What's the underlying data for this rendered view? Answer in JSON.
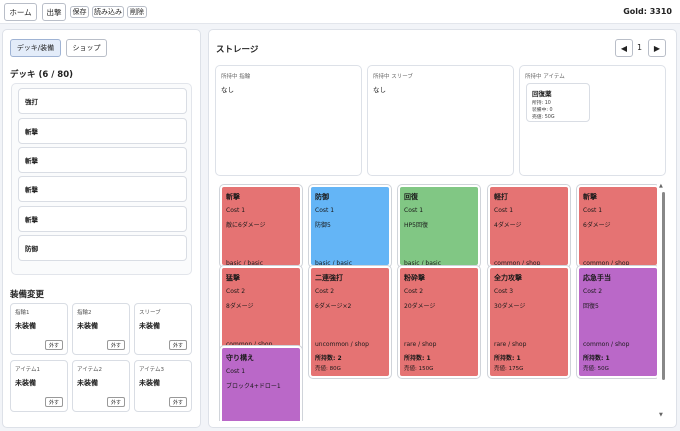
{
  "topbar": {
    "home_label": "ホーム",
    "sortie_label": "出撃",
    "save_label": "保存",
    "load_label": "読み込み",
    "delete_label": "削除",
    "gold": "Gold: 3310"
  },
  "left": {
    "tabs": [
      "デッキ/装備",
      "ショップ"
    ],
    "active_tab": "デッキ/装備",
    "deck_title": "デッキ (6 / 80)",
    "deck_cards": [
      "強打",
      "斬撃",
      "斬撃",
      "斬撃",
      "斬撃",
      "防御"
    ],
    "equip_title": "装備変更",
    "slots": [
      {
        "label": "指輪1",
        "value": "未装備",
        "remove": "外す"
      },
      {
        "label": "指輪2",
        "value": "未装備",
        "remove": "外す"
      },
      {
        "label": "スリーブ",
        "value": "未装備",
        "remove": "外す"
      },
      {
        "label": "アイテム1",
        "value": "未装備",
        "remove": "外す"
      },
      {
        "label": "アイテム2",
        "value": "未装備",
        "remove": "外す"
      },
      {
        "label": "アイテム3",
        "value": "未装備",
        "remove": "外す"
      }
    ]
  },
  "storage": {
    "title": "ストレージ",
    "page": "1",
    "prev_icon": "triangle-left",
    "next_icon": "triangle-right",
    "owned_ring_label": "所持中 指輪",
    "owned_ring_value": "なし",
    "owned_sleeve_label": "所持中 スリーブ",
    "owned_sleeve_value": "なし",
    "owned_item_label": "所持中 アイテム",
    "item_card": {
      "name": "回復薬",
      "owned": "所持: 10",
      "equipped": "装備中: 0",
      "sell": "売値: 50G"
    },
    "cards": [
      {
        "name": "斬撃",
        "cost": "Cost 1",
        "desc": "敵に6ダメージ",
        "rarity": "basic / basic",
        "owned": "",
        "sell": "",
        "color": "#e57373"
      },
      {
        "name": "防御",
        "cost": "Cost 1",
        "desc": "防御5",
        "rarity": "basic / basic",
        "owned": "",
        "sell": "",
        "color": "#64b5f6"
      },
      {
        "name": "回復",
        "cost": "Cost 1",
        "desc": "HP5回復",
        "rarity": "basic / basic",
        "owned": "",
        "sell": "",
        "color": "#81c784"
      },
      {
        "name": "軽打",
        "cost": "Cost 1",
        "desc": "4ダメージ",
        "rarity": "common / shop",
        "owned": "",
        "sell": "",
        "color": "#e57373"
      },
      {
        "name": "斬撃",
        "cost": "Cost 1",
        "desc": "6ダメージ",
        "rarity": "common / shop",
        "owned": "",
        "sell": "",
        "color": "#e57373"
      },
      {
        "name": "猛撃",
        "cost": "Cost 2",
        "desc": "8ダメージ",
        "rarity": "common / shop",
        "owned": "",
        "sell": "",
        "color": "#e57373"
      },
      {
        "name": "二連強打",
        "cost": "Cost 2",
        "desc": "6ダメージ×2",
        "rarity": "uncommon / shop",
        "owned": "所持数: 2",
        "sell": "売値: 80G",
        "color": "#e57373"
      },
      {
        "name": "粉砕撃",
        "cost": "Cost 2",
        "desc": "20ダメージ",
        "rarity": "rare / shop",
        "owned": "所持数: 1",
        "sell": "売値: 150G",
        "color": "#e57373"
      },
      {
        "name": "全力攻撃",
        "cost": "Cost 3",
        "desc": "30ダメージ",
        "rarity": "rare / shop",
        "owned": "所持数: 1",
        "sell": "売値: 175G",
        "color": "#e57373"
      },
      {
        "name": "応急手当",
        "cost": "Cost 2",
        "desc": "回復5",
        "rarity": "common / shop",
        "owned": "所持数: 1",
        "sell": "売値: 50G",
        "color": "#ba68c8"
      },
      {
        "name": "守り構え",
        "cost": "Cost 1",
        "desc": "ブロック4+ドロー1",
        "rarity": "",
        "owned": "",
        "sell": "",
        "color": "#ba68c8"
      }
    ]
  }
}
